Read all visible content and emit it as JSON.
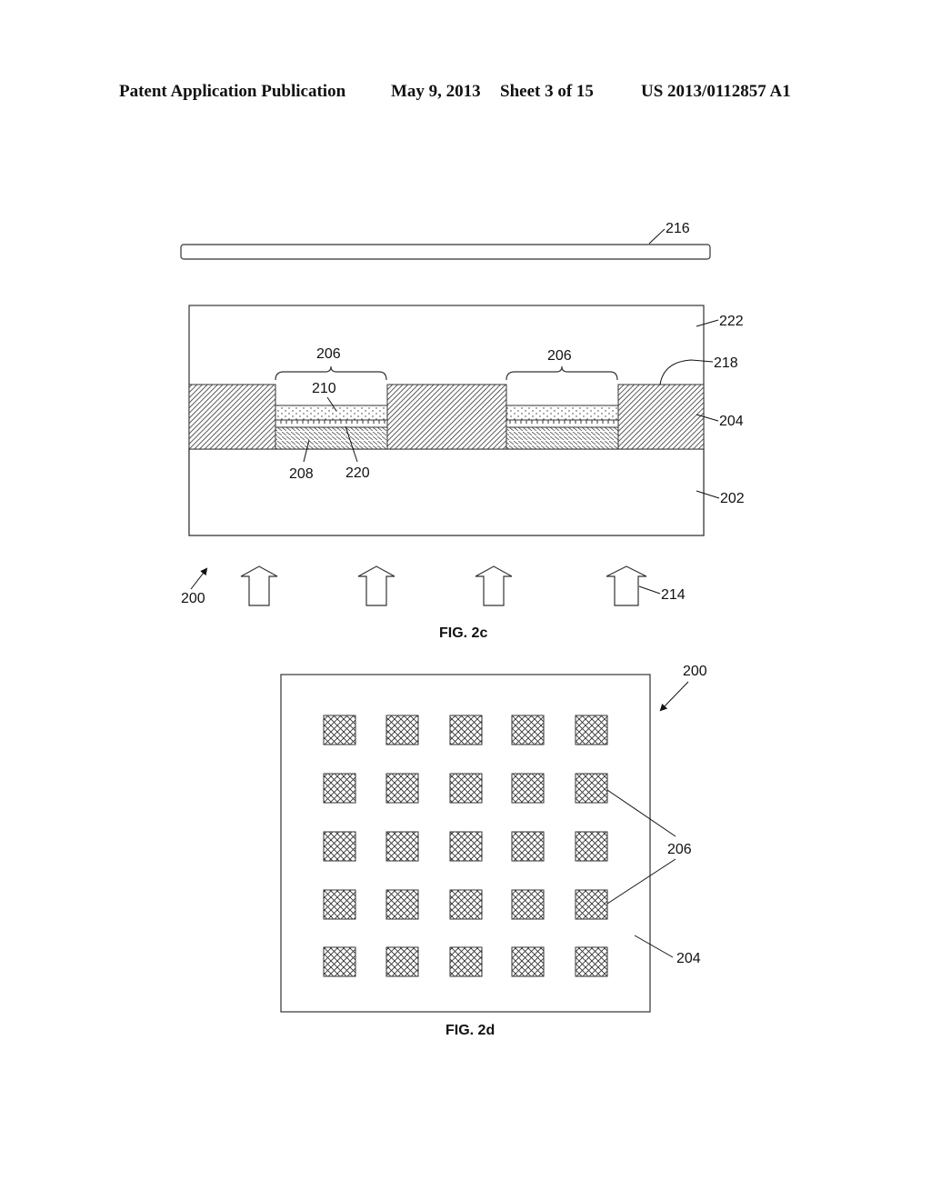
{
  "header": {
    "publication": "Patent Application Publication",
    "date": "May 9, 2013",
    "sheet": "Sheet 3 of 15",
    "number": "US 2013/0112857 A1"
  },
  "fig2c": {
    "caption": "FIG. 2c",
    "labels": {
      "cover": "216",
      "encapsulant": "222",
      "surface": "218",
      "matrix": "204",
      "substrate": "202",
      "cell_left": "206",
      "cell_right": "206",
      "top_layer": "210",
      "bottom_layer": "208",
      "interface_layer": "220",
      "device": "200",
      "light": "214"
    },
    "light_arrow_count": 4
  },
  "fig2d": {
    "caption": "FIG. 2d",
    "labels": {
      "device": "200",
      "cells": "206",
      "matrix": "204"
    },
    "grid": {
      "rows": 5,
      "cols": 5
    }
  }
}
